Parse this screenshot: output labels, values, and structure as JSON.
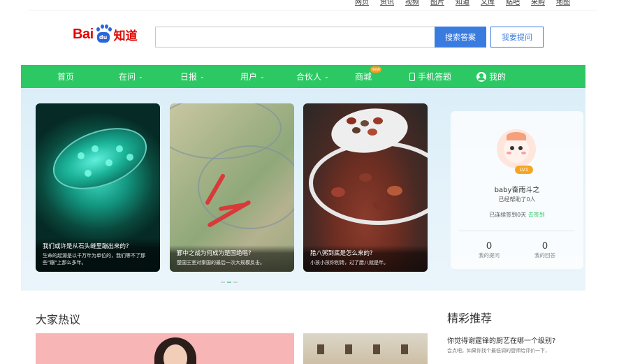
{
  "topnav": [
    "网页",
    "资讯",
    "视频",
    "图片",
    "知道",
    "文库",
    "贴吧",
    "采购",
    "地图"
  ],
  "logo": {
    "left": "Bai",
    "paw": "du",
    "right": "知道"
  },
  "search": {
    "placeholder": "",
    "value": "",
    "search_button": "搜索答案",
    "ask_button": "我要提问"
  },
  "nav": {
    "home": "首页",
    "ask": "在问",
    "daily": "日报",
    "users": "用户",
    "partners": "合伙人",
    "mall": "商城",
    "mall_badge": "new",
    "mobile": "手机答题",
    "mine": "我的"
  },
  "cards": [
    {
      "title": "我们或许是从石头缝里蹦出来的?",
      "desc": "生命的起源是以千万年为单位的，我们等不了那些\"蹦\"上那么多年。"
    },
    {
      "title": "鄞中之战为何成为楚国绝唱?",
      "desc": "楚国王室对秦国的最后一次大规模反击。"
    },
    {
      "title": "腊八粥到底是怎么来的?",
      "desc": "小孩小孩你别馋，过了腊八就是年。"
    }
  ],
  "profile": {
    "level": "LV1",
    "username": "baby奋雨斗之",
    "helped": "已经帮助了0人",
    "streak": "已连续签到0天",
    "checkin": "去签到",
    "questions_count": "0",
    "questions_label": "我的提问",
    "answers_count": "0",
    "answers_label": "我的回答"
  },
  "sections": {
    "hot_title": "大家热议",
    "rec_title": "精彩推荐",
    "rec_question": "你觉得谢霆锋的厨艺在哪一个级别?",
    "rec_answer": "会点吧。如果你找个最低调的厨师给评价一下，"
  },
  "colors": {
    "green": "#2cc864",
    "blue": "#3a7be0",
    "baidu_red": "#e10602"
  }
}
